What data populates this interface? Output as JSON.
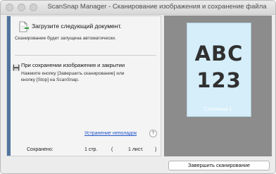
{
  "window": {
    "title": "ScanSnap Manager - Сканирование изображения и сохранение файла"
  },
  "status": {
    "heading": "Загрузите следующий документ.",
    "description": "Сканирование будет запущена автоматически."
  },
  "save_section": {
    "heading": "При сохранении изображения и закрытии",
    "line1": "Нажмите кнопку [Завершить сканирование] или",
    "line2": "кнопку [Stop] на ScanSnap."
  },
  "troubleshooting": {
    "label": "Устранение неполадок",
    "help_label": "?"
  },
  "summary": {
    "saved_label": "Сохранено:",
    "pages_count": "1 стр.",
    "paren_open": "(",
    "sheets_count": "1 лист.",
    "paren_close": ")"
  },
  "preview": {
    "line1": "ABC",
    "line2": "123",
    "page_label": "Страница 1"
  },
  "buttons": {
    "finish": "Завершить сканирование"
  },
  "colors": {
    "accent": "#51749e",
    "preview_bg": "#8c8c8c",
    "page_bg": "#d5eefa",
    "link": "#2255cc"
  },
  "icons": {
    "document": "document-arrow-icon",
    "save": "floppy-disk-icon",
    "help": "help-icon"
  }
}
